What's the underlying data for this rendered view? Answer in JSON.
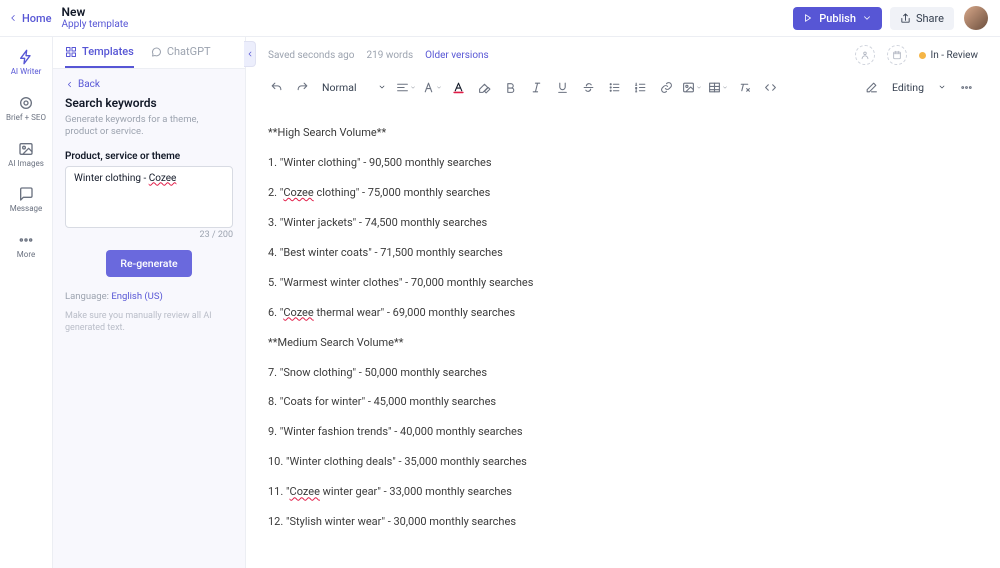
{
  "header": {
    "home_label": "Home",
    "doc_title": "New",
    "apply_template": "Apply template",
    "publish_label": "Publish",
    "share_label": "Share"
  },
  "rail": {
    "ai_writer": "AI Writer",
    "brief_seo": "Brief + SEO",
    "ai_images": "AI Images",
    "message": "Message",
    "more": "More"
  },
  "panel": {
    "tab_templates": "Templates",
    "tab_chatgpt": "ChatGPT",
    "back_label": "Back",
    "heading": "Search keywords",
    "subheading": "Generate keywords for a theme, product or service.",
    "field_label": "Product, service or theme",
    "theme_prefix": "Winter clothing - ",
    "theme_brand": "Cozee",
    "counter": "23 / 200",
    "regenerate_label": "Re-generate",
    "language_label": "Language:",
    "language_value": "English (US)",
    "review_note": "Make sure you manually review all AI generated text."
  },
  "meta": {
    "saved": "Saved seconds ago",
    "word_count": "219 words",
    "older_versions": "Older versions",
    "status": "In - Review"
  },
  "toolbar": {
    "style_label": "Normal",
    "mode_label": "Editing"
  },
  "document": {
    "lines": [
      "**High Search Volume**",
      "1. \"Winter clothing\" - 90,500 monthly searches",
      "2. \"Cozee clothing\" - 75,000 monthly searches",
      "3. \"Winter jackets\" - 74,500 monthly searches",
      "4. \"Best winter coats\" - 71,500 monthly searches",
      "5. \"Warmest winter clothes\" - 70,000 monthly searches",
      "6. \"Cozee thermal wear\" - 69,000 monthly searches",
      "**Medium Search Volume**",
      "7. \"Snow clothing\" - 50,000 monthly searches",
      "8. \"Coats for winter\" - 45,000 monthly searches",
      "9. \"Winter fashion trends\" - 40,000 monthly searches",
      "10.  \"Winter clothing deals\" - 35,000 monthly searches",
      "11. \"Cozee winter gear\" - 33,000 monthly searches",
      "12. \"Stylish winter wear\" - 30,000 monthly searches"
    ]
  }
}
